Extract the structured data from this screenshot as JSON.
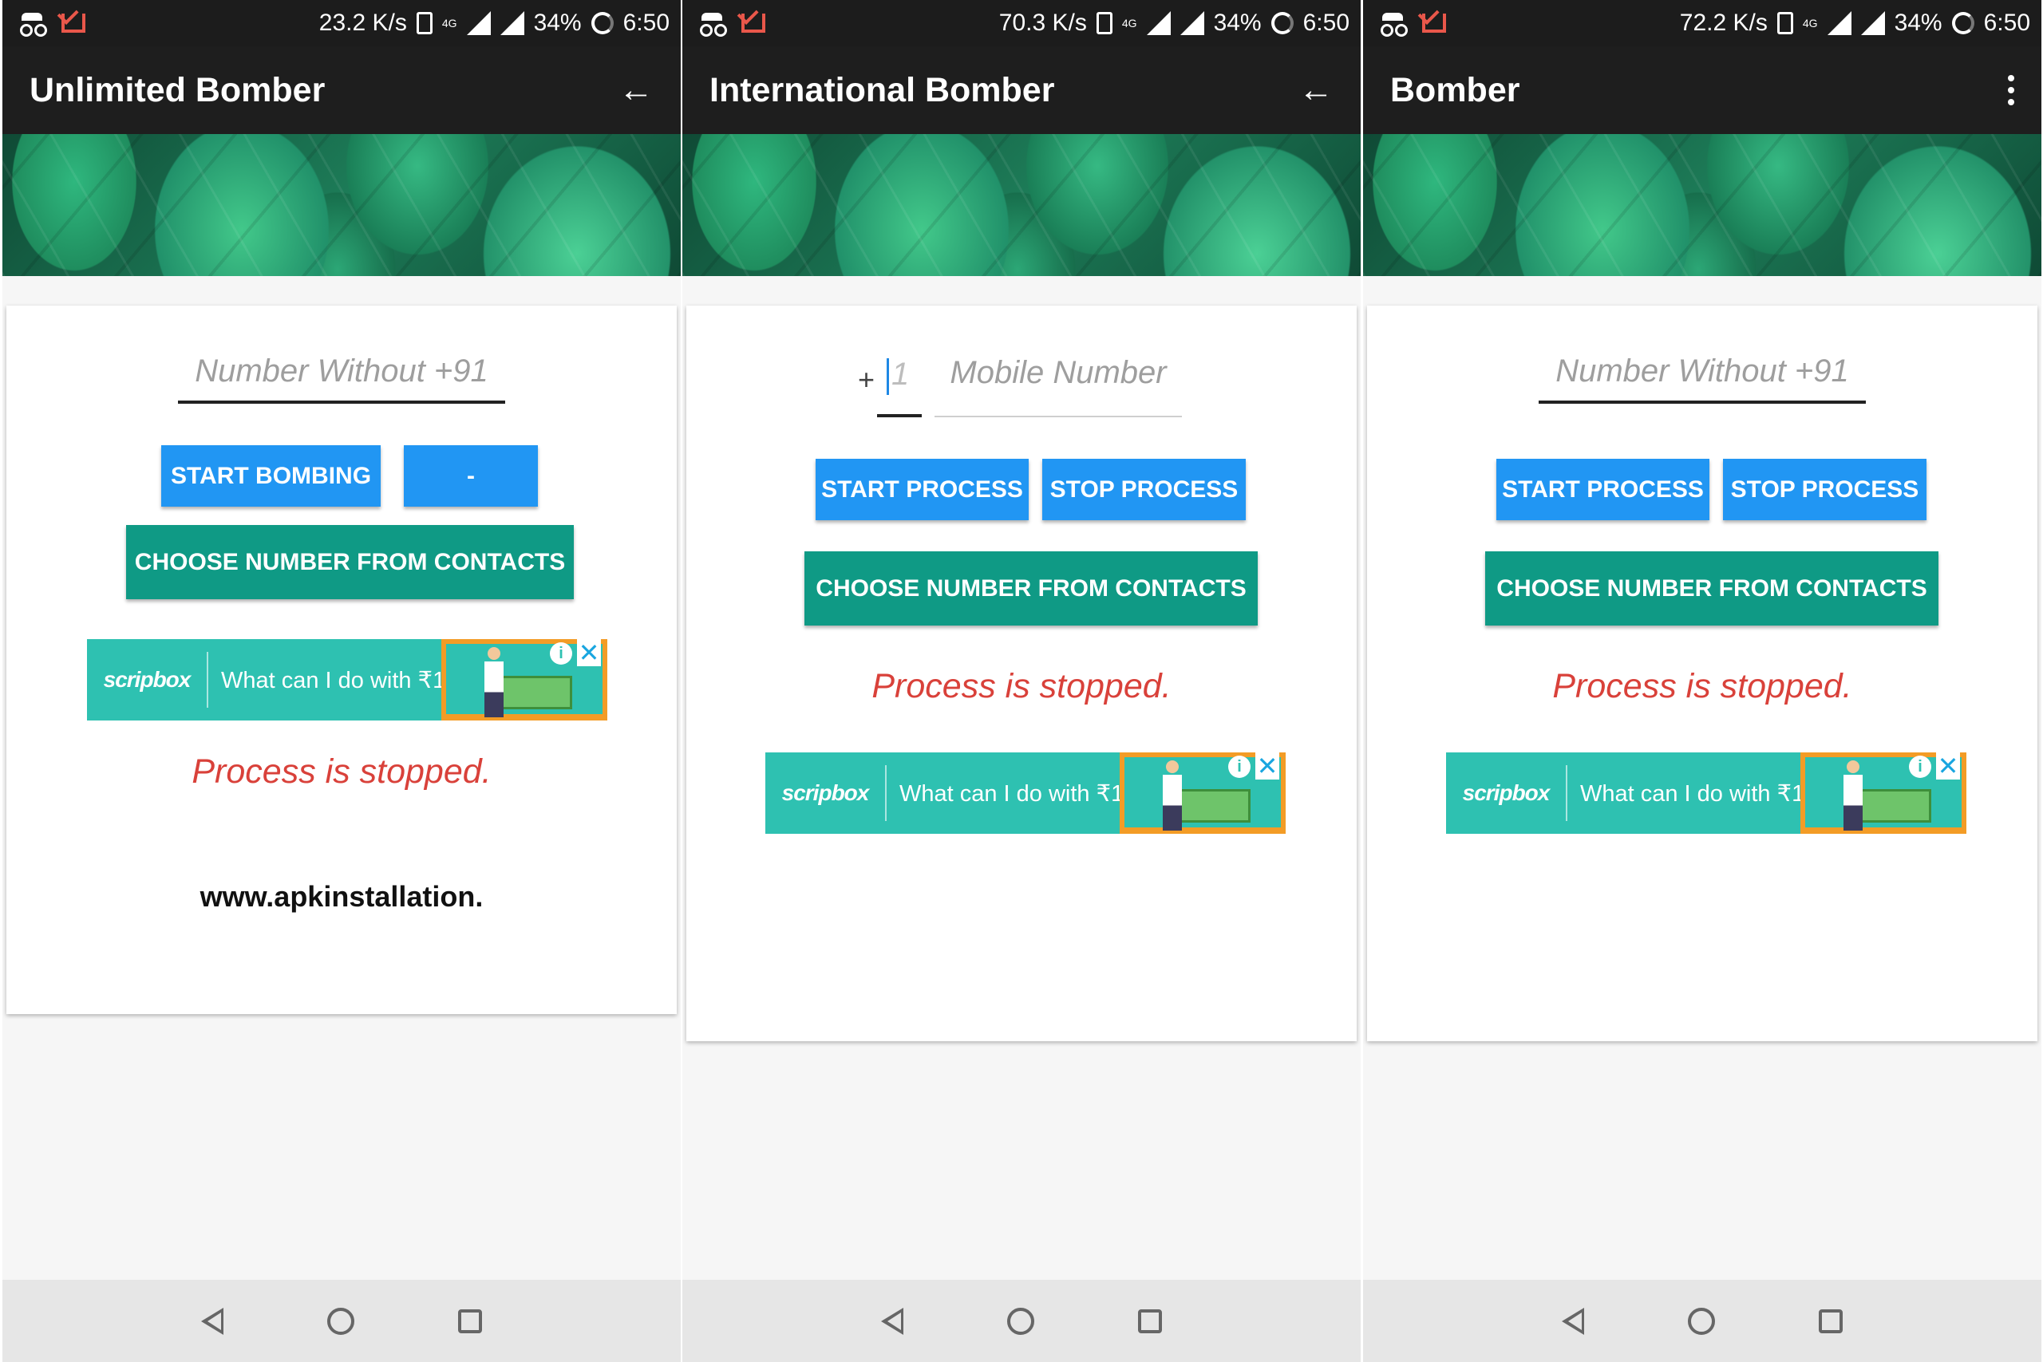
{
  "screens": [
    {
      "status": {
        "speed": "23.2 K/s",
        "network": "4G",
        "battery": "34%",
        "time": "6:50"
      },
      "app_title": "Unlimited Bomber",
      "input_placeholder": "Number Without +91",
      "start_button": "START BOMBING",
      "stop_button": "-",
      "contacts_button": "CHOOSE NUMBER FROM CONTACTS",
      "ad": {
        "logo": "scripbox",
        "text": "What can I do with ₹1000"
      },
      "status_message": "Process is stopped.",
      "watermark": "www.apkinstallation."
    },
    {
      "status": {
        "speed": "70.3 K/s",
        "network": "4G",
        "battery": "34%",
        "time": "6:50"
      },
      "app_title": "International Bomber",
      "plus_sign": "+",
      "country_code_placeholder": "1",
      "input_placeholder": "Mobile Number",
      "start_button": "START PROCESS",
      "stop_button": "STOP PROCESS",
      "contacts_button": "CHOOSE NUMBER FROM CONTACTS",
      "status_message": "Process is stopped.",
      "ad": {
        "logo": "scripbox",
        "text": "What can I do with ₹1000"
      }
    },
    {
      "status": {
        "speed": "72.2 K/s",
        "network": "4G",
        "battery": "34%",
        "time": "6:50"
      },
      "app_title": "Bomber",
      "input_placeholder": "Number Without +91",
      "start_button": "START PROCESS",
      "stop_button": "STOP PROCESS",
      "contacts_button": "CHOOSE NUMBER FROM CONTACTS",
      "status_message": "Process is stopped.",
      "ad": {
        "logo": "scripbox",
        "text": "What can I do with ₹1000"
      }
    }
  ],
  "ad_info_symbol": "i",
  "ad_close_symbol": "✕",
  "back_arrow_symbol": "←",
  "colors": {
    "blue_button": "#2196f3",
    "teal_button": "#0f9a85",
    "status_red": "#d9413a",
    "ad_teal": "#2ec1b1",
    "ad_orange": "#f39c26"
  }
}
